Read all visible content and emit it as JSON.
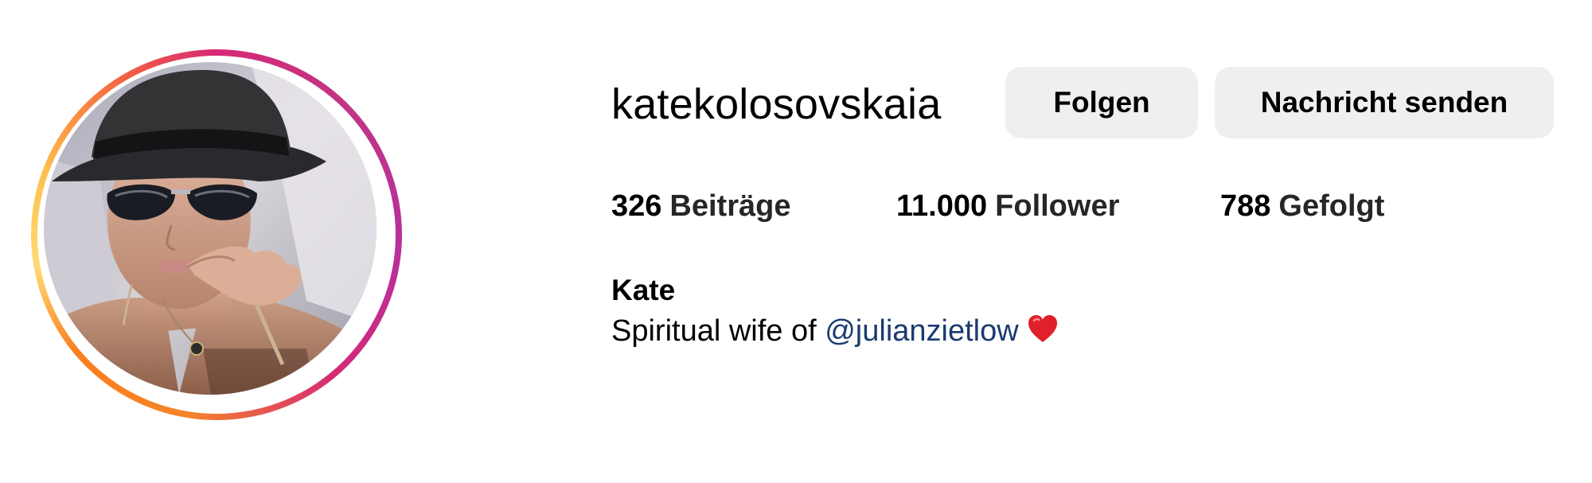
{
  "profile": {
    "username": "katekolosovskaia",
    "actions": {
      "follow_label": "Folgen",
      "message_label": "Nachricht senden"
    },
    "stats": {
      "posts_count": "326",
      "posts_label": "Beiträge",
      "followers_count": "11.000",
      "followers_label": "Follower",
      "following_count": "788",
      "following_label": "Gefolgt"
    },
    "full_name": "Kate",
    "bio": {
      "text_before": "Spiritual wife of",
      "mention": "@julianzietlow",
      "emoji_icon": "red-heart-icon"
    },
    "avatar": {
      "icon": "profile-photo",
      "ring_colors": [
        "#d62976",
        "#b82f9e",
        "#f58529",
        "#feda75"
      ]
    }
  },
  "colors": {
    "button_background": "#efefef",
    "mention_link": "#1b3a70",
    "heart": "#e0202a"
  }
}
